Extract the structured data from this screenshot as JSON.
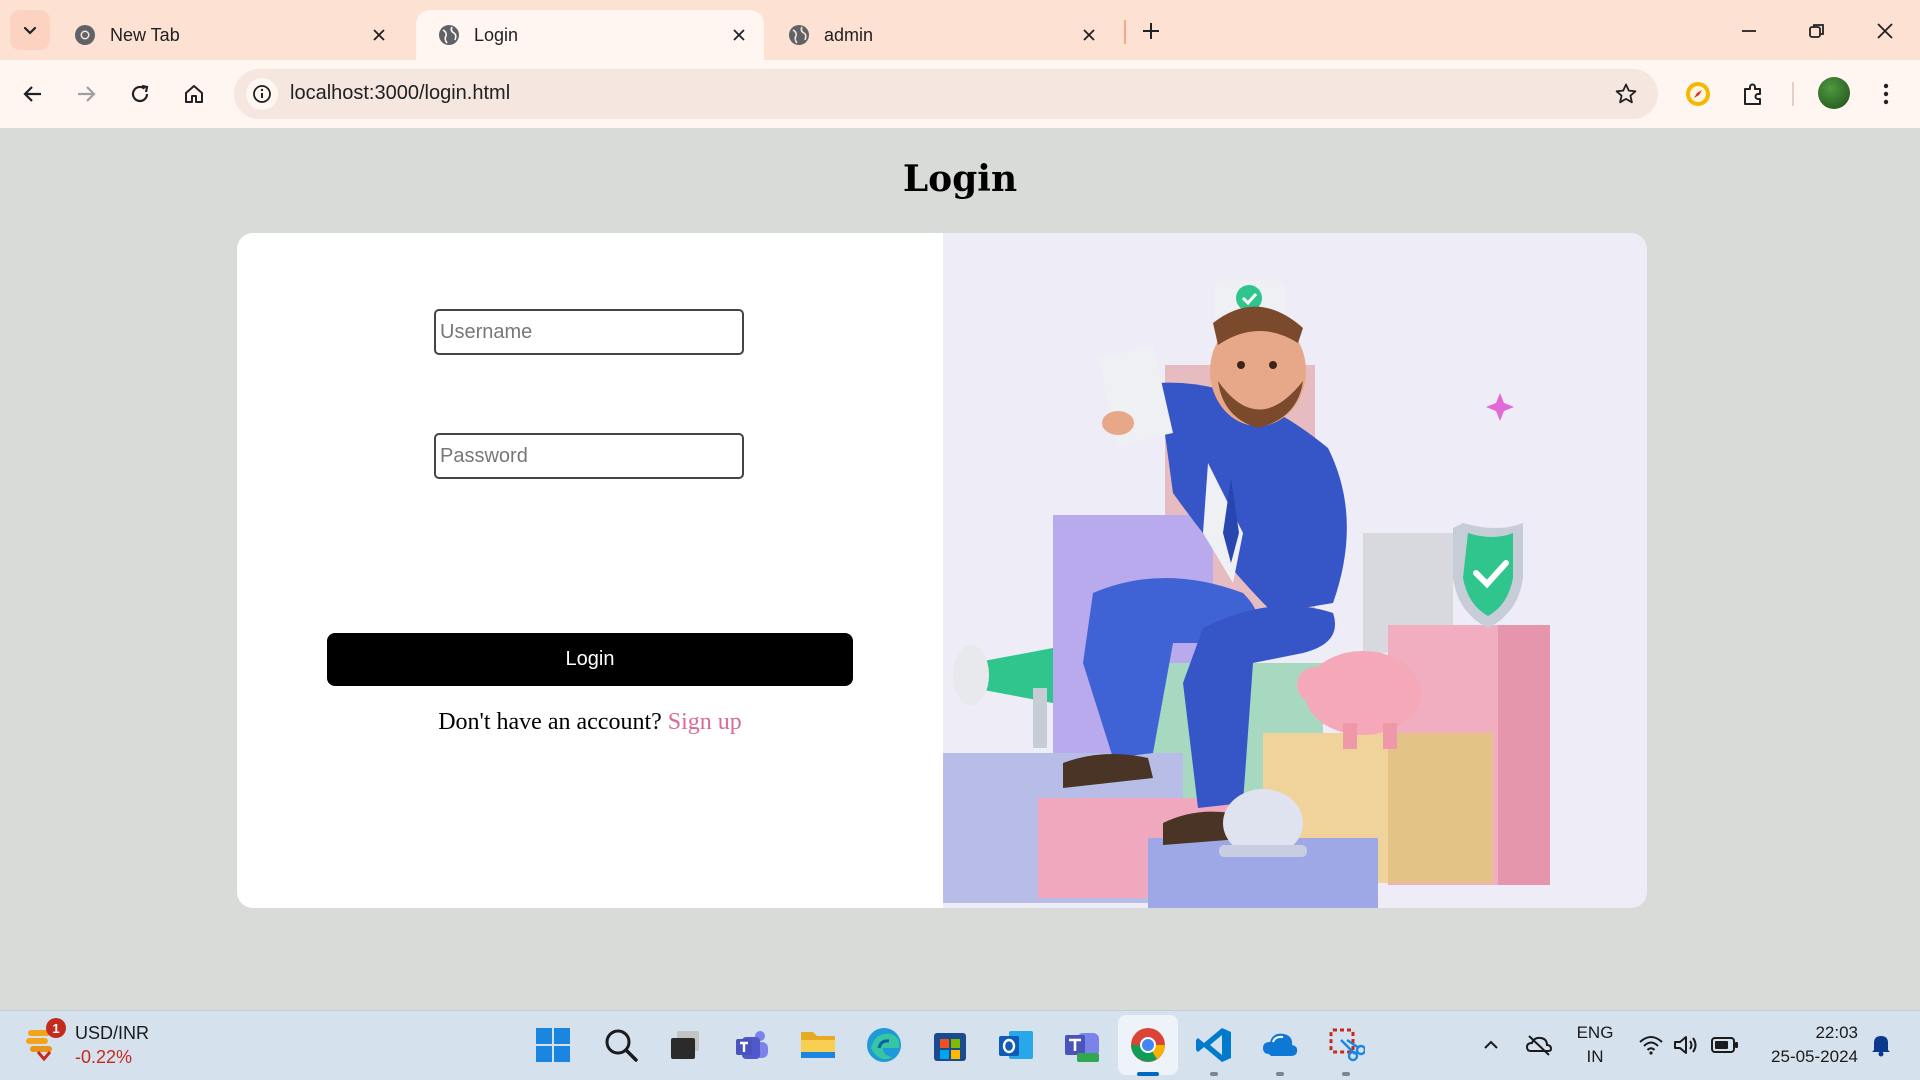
{
  "browser": {
    "tabs": [
      {
        "title": "New Tab",
        "active": false
      },
      {
        "title": "Login",
        "active": true
      },
      {
        "title": "admin",
        "active": false
      }
    ],
    "url": "localhost:3000/login.html"
  },
  "page": {
    "title": "Login",
    "username_placeholder": "Username",
    "password_placeholder": "Password",
    "login_button": "Login",
    "signup_prompt": "Don't have an account?",
    "signup_link": "Sign up"
  },
  "colors": {
    "tab_strip": "#fde1d3",
    "toolbar": "#fff6f2",
    "page_bg": "#d9dbd9",
    "button": "#000000",
    "link": "#d96a9a"
  },
  "taskbar": {
    "widget_badge": "1",
    "widget_title": "USD/INR",
    "widget_change": "-0.22%",
    "lang_top": "ENG",
    "lang_bottom": "IN",
    "time": "22:03",
    "date": "25-05-2024",
    "apps": [
      "start-icon",
      "search-icon",
      "task-view-icon",
      "teams-icon",
      "file-explorer-icon",
      "edge-icon",
      "store-icon",
      "outlook-icon",
      "teams-new-icon",
      "chrome-icon",
      "vscode-icon",
      "onedrive-icon",
      "snipping-tool-icon"
    ]
  }
}
